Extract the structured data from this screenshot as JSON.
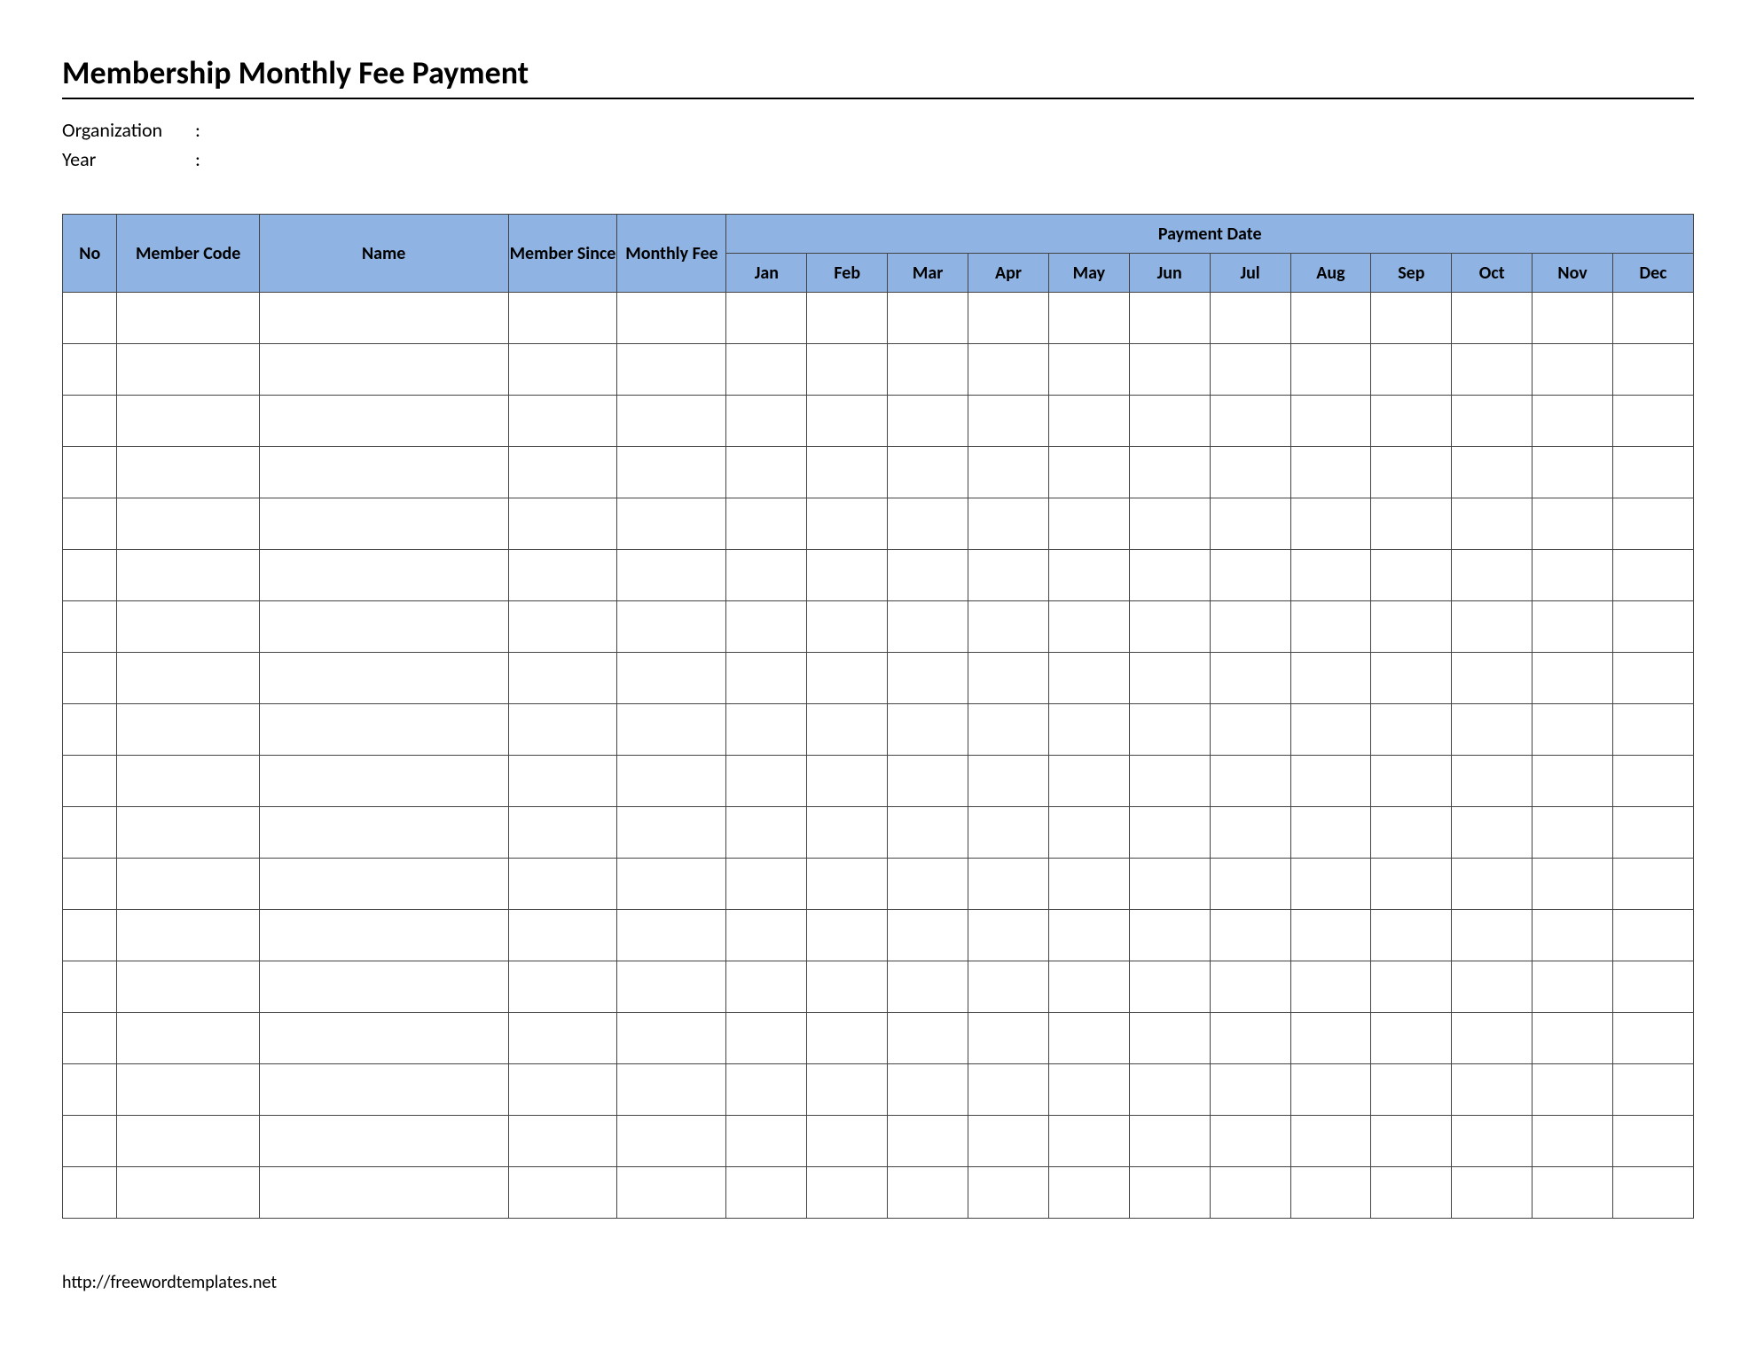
{
  "title": "Membership Monthly Fee Payment",
  "meta": {
    "organization_label": "Organization",
    "year_label": "Year",
    "colon": ":",
    "organization_value": "",
    "year_value": ""
  },
  "table": {
    "headers": {
      "no": "No",
      "member_code": "Member Code",
      "name": "Name",
      "member_since": "Member Since",
      "monthly_fee": "Monthly Fee",
      "payment_date": "Payment Date"
    },
    "months": [
      "Jan",
      "Feb",
      "Mar",
      "Apr",
      "May",
      "Jun",
      "Jul",
      "Aug",
      "Sep",
      "Oct",
      "Nov",
      "Dec"
    ],
    "rows": [
      {
        "no": "",
        "member_code": "",
        "name": "",
        "member_since": "",
        "monthly_fee": "",
        "payments": [
          "",
          "",
          "",
          "",
          "",
          "",
          "",
          "",
          "",
          "",
          "",
          ""
        ]
      },
      {
        "no": "",
        "member_code": "",
        "name": "",
        "member_since": "",
        "monthly_fee": "",
        "payments": [
          "",
          "",
          "",
          "",
          "",
          "",
          "",
          "",
          "",
          "",
          "",
          ""
        ]
      },
      {
        "no": "",
        "member_code": "",
        "name": "",
        "member_since": "",
        "monthly_fee": "",
        "payments": [
          "",
          "",
          "",
          "",
          "",
          "",
          "",
          "",
          "",
          "",
          "",
          ""
        ]
      },
      {
        "no": "",
        "member_code": "",
        "name": "",
        "member_since": "",
        "monthly_fee": "",
        "payments": [
          "",
          "",
          "",
          "",
          "",
          "",
          "",
          "",
          "",
          "",
          "",
          ""
        ]
      },
      {
        "no": "",
        "member_code": "",
        "name": "",
        "member_since": "",
        "monthly_fee": "",
        "payments": [
          "",
          "",
          "",
          "",
          "",
          "",
          "",
          "",
          "",
          "",
          "",
          ""
        ]
      },
      {
        "no": "",
        "member_code": "",
        "name": "",
        "member_since": "",
        "monthly_fee": "",
        "payments": [
          "",
          "",
          "",
          "",
          "",
          "",
          "",
          "",
          "",
          "",
          "",
          ""
        ]
      },
      {
        "no": "",
        "member_code": "",
        "name": "",
        "member_since": "",
        "monthly_fee": "",
        "payments": [
          "",
          "",
          "",
          "",
          "",
          "",
          "",
          "",
          "",
          "",
          "",
          ""
        ]
      },
      {
        "no": "",
        "member_code": "",
        "name": "",
        "member_since": "",
        "monthly_fee": "",
        "payments": [
          "",
          "",
          "",
          "",
          "",
          "",
          "",
          "",
          "",
          "",
          "",
          ""
        ]
      },
      {
        "no": "",
        "member_code": "",
        "name": "",
        "member_since": "",
        "monthly_fee": "",
        "payments": [
          "",
          "",
          "",
          "",
          "",
          "",
          "",
          "",
          "",
          "",
          "",
          ""
        ]
      },
      {
        "no": "",
        "member_code": "",
        "name": "",
        "member_since": "",
        "monthly_fee": "",
        "payments": [
          "",
          "",
          "",
          "",
          "",
          "",
          "",
          "",
          "",
          "",
          "",
          ""
        ]
      },
      {
        "no": "",
        "member_code": "",
        "name": "",
        "member_since": "",
        "monthly_fee": "",
        "payments": [
          "",
          "",
          "",
          "",
          "",
          "",
          "",
          "",
          "",
          "",
          "",
          ""
        ]
      },
      {
        "no": "",
        "member_code": "",
        "name": "",
        "member_since": "",
        "monthly_fee": "",
        "payments": [
          "",
          "",
          "",
          "",
          "",
          "",
          "",
          "",
          "",
          "",
          "",
          ""
        ]
      },
      {
        "no": "",
        "member_code": "",
        "name": "",
        "member_since": "",
        "monthly_fee": "",
        "payments": [
          "",
          "",
          "",
          "",
          "",
          "",
          "",
          "",
          "",
          "",
          "",
          ""
        ]
      },
      {
        "no": "",
        "member_code": "",
        "name": "",
        "member_since": "",
        "monthly_fee": "",
        "payments": [
          "",
          "",
          "",
          "",
          "",
          "",
          "",
          "",
          "",
          "",
          "",
          ""
        ]
      },
      {
        "no": "",
        "member_code": "",
        "name": "",
        "member_since": "",
        "monthly_fee": "",
        "payments": [
          "",
          "",
          "",
          "",
          "",
          "",
          "",
          "",
          "",
          "",
          "",
          ""
        ]
      },
      {
        "no": "",
        "member_code": "",
        "name": "",
        "member_since": "",
        "monthly_fee": "",
        "payments": [
          "",
          "",
          "",
          "",
          "",
          "",
          "",
          "",
          "",
          "",
          "",
          ""
        ]
      },
      {
        "no": "",
        "member_code": "",
        "name": "",
        "member_since": "",
        "monthly_fee": "",
        "payments": [
          "",
          "",
          "",
          "",
          "",
          "",
          "",
          "",
          "",
          "",
          "",
          ""
        ]
      },
      {
        "no": "",
        "member_code": "",
        "name": "",
        "member_since": "",
        "monthly_fee": "",
        "payments": [
          "",
          "",
          "",
          "",
          "",
          "",
          "",
          "",
          "",
          "",
          "",
          ""
        ]
      }
    ]
  },
  "footer": {
    "url": "http://freewordtemplates.net"
  },
  "colors": {
    "header_bg": "#8fb4e3",
    "border": "#444444"
  }
}
